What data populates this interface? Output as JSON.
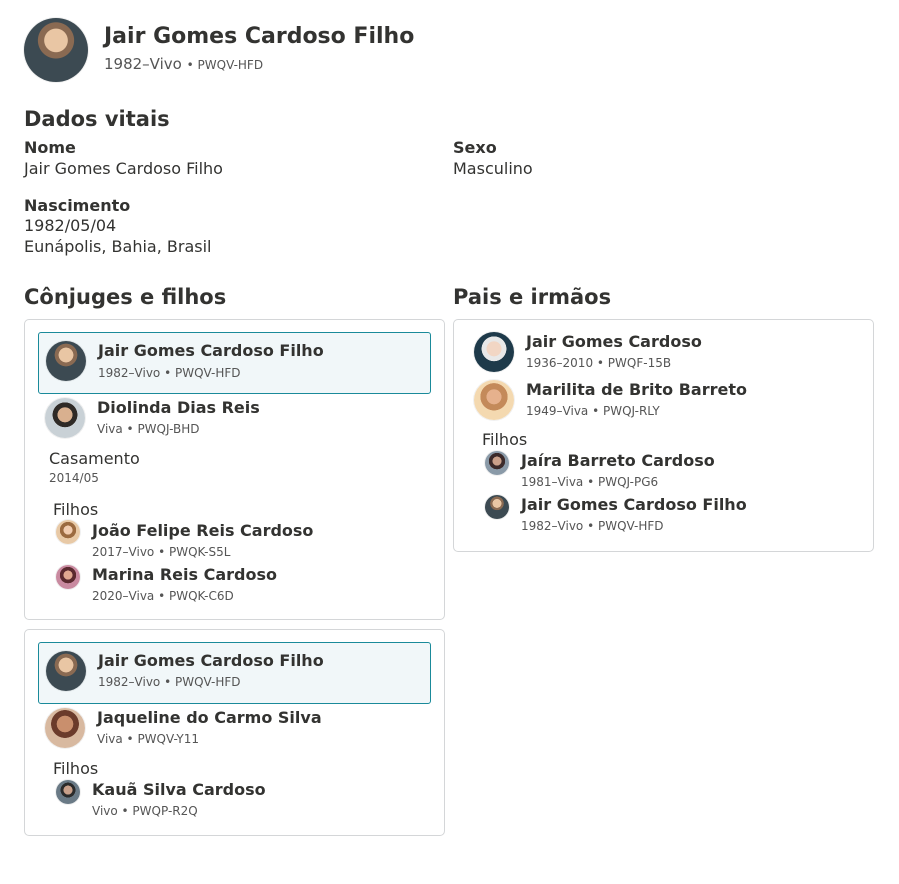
{
  "header": {
    "name": "Jair Gomes Cardoso Filho",
    "lifespan": "1982–Vivo",
    "pid": "PWQV-HFD"
  },
  "vitals": {
    "title": "Dados vitais",
    "name_label": "Nome",
    "name_value": "Jair Gomes Cardoso Filho",
    "sex_label": "Sexo",
    "sex_value": "Masculino",
    "birth_label": "Nascimento",
    "birth_date": "1982/05/04",
    "birth_place": "Eunápolis, Bahia, Brasil"
  },
  "spouses_section": {
    "title": "Cônjuges e filhos",
    "families": [
      {
        "self": {
          "name": "Jair Gomes Cardoso Filho",
          "meta": "1982–Vivo • PWQV-HFD"
        },
        "spouse": {
          "name": "Diolinda Dias Reis",
          "meta": "Viva • PWQJ-BHD"
        },
        "marriage_label": "Casamento",
        "marriage_date": "2014/05",
        "children_label": "Filhos",
        "children": [
          {
            "name": "João Felipe Reis Cardoso",
            "meta": "2017–Vivo • PWQK-S5L"
          },
          {
            "name": "Marina Reis Cardoso",
            "meta": "2020–Viva • PWQK-C6D"
          }
        ]
      },
      {
        "self": {
          "name": "Jair Gomes Cardoso Filho",
          "meta": "1982–Vivo • PWQV-HFD"
        },
        "spouse": {
          "name": "Jaqueline do Carmo Silva",
          "meta": "Viva • PWQV-Y11"
        },
        "children_label": "Filhos",
        "children": [
          {
            "name": "Kauã Silva Cardoso",
            "meta": "Vivo • PWQP-R2Q"
          }
        ]
      }
    ]
  },
  "parents_section": {
    "title": "Pais e irmãos",
    "father": {
      "name": "Jair Gomes Cardoso",
      "meta": "1936–2010 • PWQF-15B"
    },
    "mother": {
      "name": "Marilita de Brito Barreto",
      "meta": "1949–Viva • PWQJ-RLY"
    },
    "children_label": "Filhos",
    "children": [
      {
        "name": "Jaíra Barreto Cardoso",
        "meta": "1981–Viva • PWQJ-PG6"
      },
      {
        "name": "Jair Gomes Cardoso Filho",
        "meta": "1982–Vivo • PWQV-HFD"
      }
    ]
  }
}
